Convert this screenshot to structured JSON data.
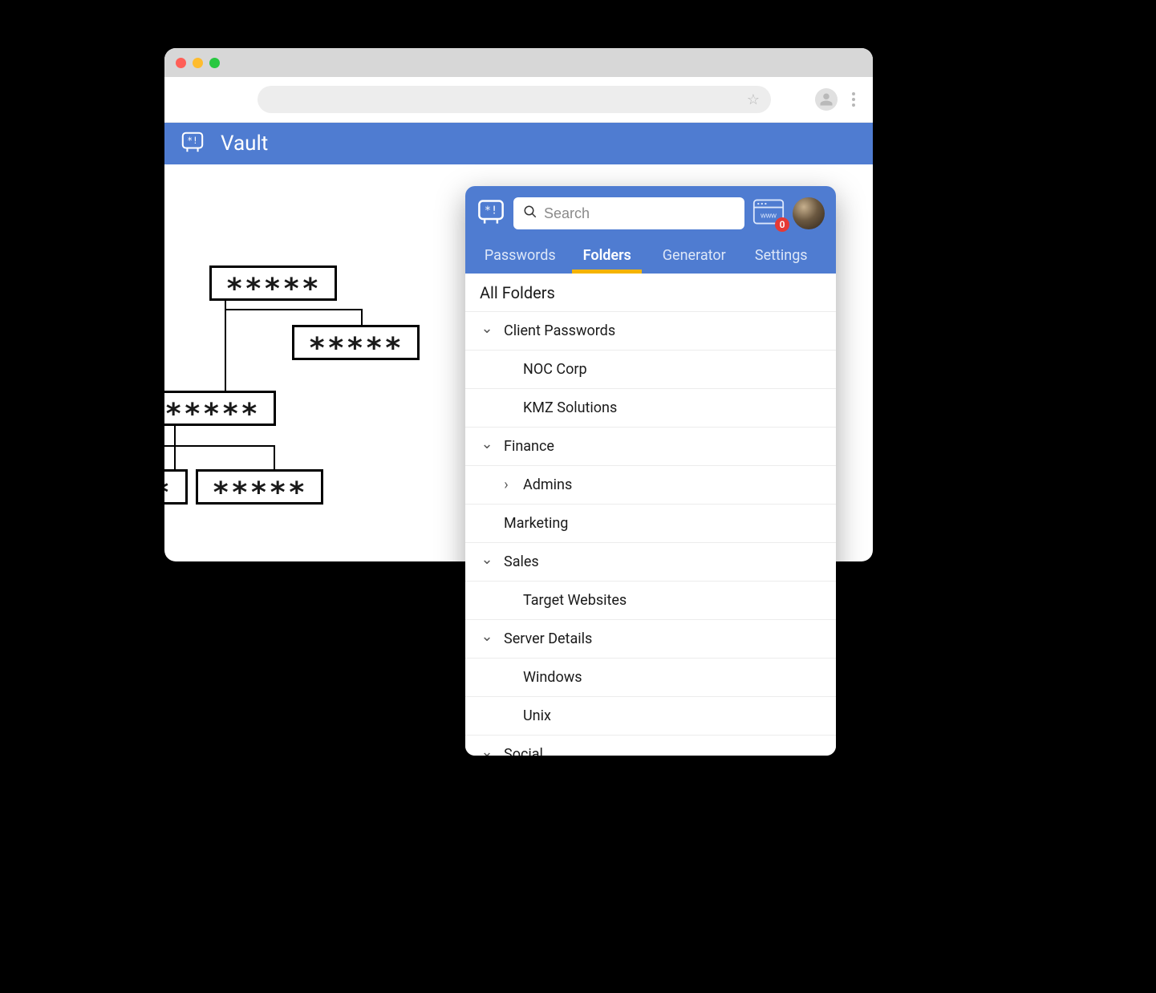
{
  "app": {
    "title": "Vault"
  },
  "tree": {
    "mask": "*****"
  },
  "ext": {
    "search_placeholder": "Search",
    "badge": "0",
    "tabs": {
      "passwords": "Passwords",
      "folders": "Folders",
      "generator": "Generator",
      "settings": "Settings",
      "active": "folders"
    },
    "list_title": "All Folders",
    "folders": [
      {
        "name": "Client Passwords",
        "expanded": true,
        "children": [
          "NOC Corp",
          "KMZ Solutions"
        ]
      },
      {
        "name": "Finance",
        "expanded": true,
        "children": [
          {
            "name": "Admins",
            "hasChildren": true
          }
        ]
      },
      {
        "name": "Marketing",
        "expanded": null
      },
      {
        "name": "Sales",
        "expanded": true,
        "children": [
          "Target Websites"
        ]
      },
      {
        "name": "Server Details",
        "expanded": true,
        "children": [
          "Windows",
          "Unix"
        ]
      },
      {
        "name": "Social",
        "expanded": true
      }
    ]
  },
  "colors": {
    "brand": "#4f7cd1",
    "accent": "#f5b400",
    "badge": "#e53935"
  }
}
